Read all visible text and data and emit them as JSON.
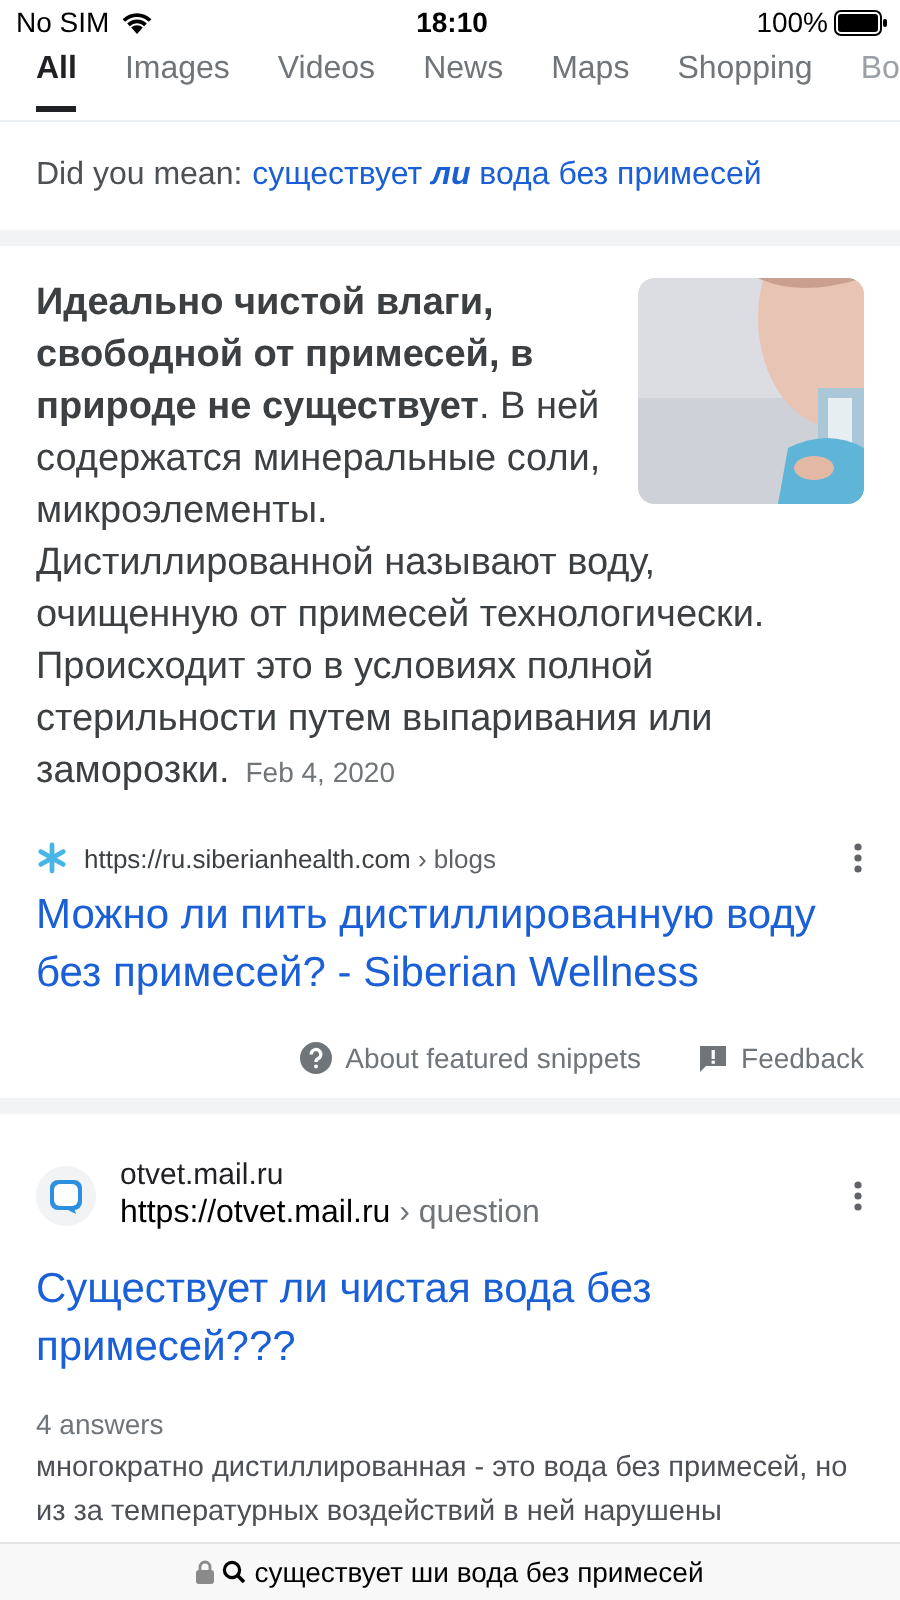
{
  "status_bar": {
    "carrier": "No SIM",
    "time": "18:10",
    "battery": "100%"
  },
  "tabs": [
    {
      "label": "All",
      "selected": true
    },
    {
      "label": "Images",
      "selected": false
    },
    {
      "label": "Videos",
      "selected": false
    },
    {
      "label": "News",
      "selected": false
    },
    {
      "label": "Maps",
      "selected": false
    },
    {
      "label": "Shopping",
      "selected": false
    },
    {
      "label": "Bo",
      "selected": false
    }
  ],
  "did_you_mean": {
    "label": "Did you mean:",
    "suggestion": "существует **ли** вода без примесей"
  },
  "featured_snippet": {
    "text": [
      "**Идеально чистой влаги, свободной от примесей, в природе не существует**. В ней содержатся минеральные соли, микроэлементы.",
      "Дистиллированной называют воду, очищенную от примесей технологически.",
      "Происходит это в условиях полной стерильности путем выпаривания или",
      "заморозки."
    ],
    "date": "Feb 4, 2020",
    "url": "https://ru.siberianhealth.com",
    "path": "› blogs",
    "title": "Можно ли пить дистиллированную воду без примесей? - Siberian Wellness",
    "about": "About featured snippets",
    "feedback": "Feedback"
  },
  "results": [
    {
      "site": "otvet.mail.ru",
      "url": "https://otvet.mail.ru",
      "path": "› question",
      "title": "Существует ли чистая вода без примесей???",
      "meta": "4 answers",
      "snippet": "многократно дистиллированная - это вода без примесей, но из за температурных воздействий в ней нарушены"
    }
  ],
  "address_bar": {
    "text": "существует ши вода без примесей"
  }
}
